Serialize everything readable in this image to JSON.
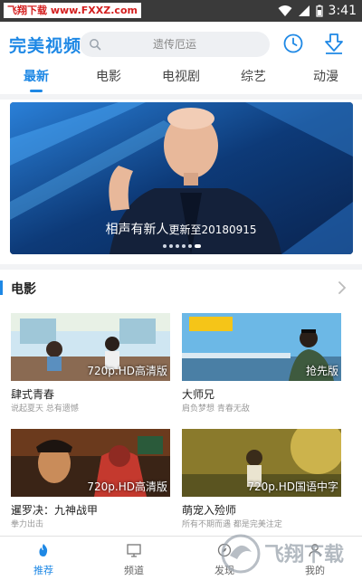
{
  "status_bar": {
    "watermark": "飞翔下载 www.FXXZ.com",
    "time": "3:41"
  },
  "header": {
    "app_title": "完美视频",
    "search_placeholder": "遗传厄运"
  },
  "tabs": [
    {
      "label": "最新",
      "active": true
    },
    {
      "label": "电影",
      "active": false
    },
    {
      "label": "电视剧",
      "active": false
    },
    {
      "label": "综艺",
      "active": false
    },
    {
      "label": "动漫",
      "active": false
    }
  ],
  "banner": {
    "title": "相声有新人",
    "subtitle": "更新至20180915",
    "page_count": 6,
    "active_index": 5
  },
  "section": {
    "title": "电影"
  },
  "movies": [
    {
      "title": "肆式青春",
      "subtitle": "说起夏天 总有遗憾",
      "badge": "720p.HD高清版"
    },
    {
      "title": "大师兄",
      "subtitle": "肩负梦想 青春无敌",
      "badge": "抢先版"
    },
    {
      "title": "暹罗决：九神战甲",
      "subtitle": "拳力出击",
      "badge": "720p.HD高清版"
    },
    {
      "title": "萌宠入殓师",
      "subtitle": "所有不期而遇 都是完美注定",
      "badge": "720p.HD国语中字"
    }
  ],
  "bottom_nav": [
    {
      "label": "推荐",
      "icon": "flame-icon",
      "active": true
    },
    {
      "label": "频道",
      "icon": "tv-icon",
      "active": false
    },
    {
      "label": "发现",
      "icon": "compass-icon",
      "active": false
    },
    {
      "label": "我的",
      "icon": "user-icon",
      "active": false
    }
  ],
  "watermark_logo": "飞翔下载",
  "colors": {
    "accent": "#1e88e5",
    "status_bar": "#3a3a3a",
    "watermark_red": "#d42020"
  }
}
